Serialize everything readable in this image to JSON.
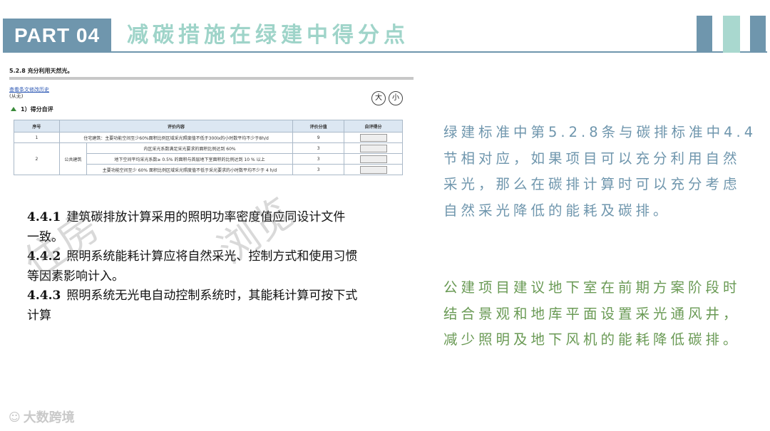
{
  "header": {
    "part_label": "PART 04",
    "title": "减碳措施在绿建中得分点",
    "colors": {
      "accent_blue": "#6f96ad",
      "accent_mint": "#9fd4c9"
    }
  },
  "standard_table": {
    "heading": "5.2.8 充分利用天然光。",
    "history_link": "查看条文修改历史",
    "sub_note": "(从无)",
    "size_large": "大",
    "size_small": "小",
    "section_title": "1）得分自评",
    "columns": [
      "序号",
      "评价内容",
      "评价分值",
      "自评得分"
    ],
    "rows": [
      {
        "no": "1",
        "category": "",
        "content": "住宅建筑：主要功能空间至少60%面积比例区域采光照度值不低于300lx的小时数平均不少于8h/d",
        "score": "9"
      },
      {
        "no": "2",
        "category": "公共建筑",
        "content": "内区采光系数满足采光要求的面积比例达到 60%",
        "score": "3"
      },
      {
        "no": "",
        "category": "",
        "content": "地下空间平均采光系数≥ 0.5% 的面积与首层地下室面积的比例达到 10 % 以上",
        "score": "3"
      },
      {
        "no": "",
        "category": "",
        "content": "主要功能空间至少 60% 面积比例区域采光照度值不低于采光要求的小时数平均不少于 4 h/d",
        "score": "3"
      }
    ]
  },
  "clauses": [
    {
      "num": "4.4.1",
      "text": "建筑碳排放计算采用的照明功率密度值应同设计文件"
    },
    {
      "num": "",
      "text": "一致。"
    },
    {
      "num": "4.4.2",
      "text": "照明系统能耗计算应将自然采光、控制方式和使用习惯"
    },
    {
      "num": "",
      "text": "等因素影响计入。"
    },
    {
      "num": "4.4.3",
      "text": "照明系统无光电自动控制系统时，其能耗计算可按下式"
    },
    {
      "num": "",
      "text": "计算"
    }
  ],
  "watermark": {
    "left": "住房",
    "right": "浏览"
  },
  "right_text": {
    "paragraph_1": "绿建标准中第5.2.8条与碳排标准中4.4节相对应，如果项目可以充分利用自然采光，那么在碳排计算时可以充分考虑自然采光降低的能耗及碳排。",
    "paragraph_2": "公建项目建议地下室在前期方案阶段时结合景观和地库平面设置采光通风井，减少照明及地下风机的能耗降低碳排。"
  },
  "footer": {
    "logo_text": "大数跨境",
    "logo_icon": "chat-bubble-icon"
  }
}
